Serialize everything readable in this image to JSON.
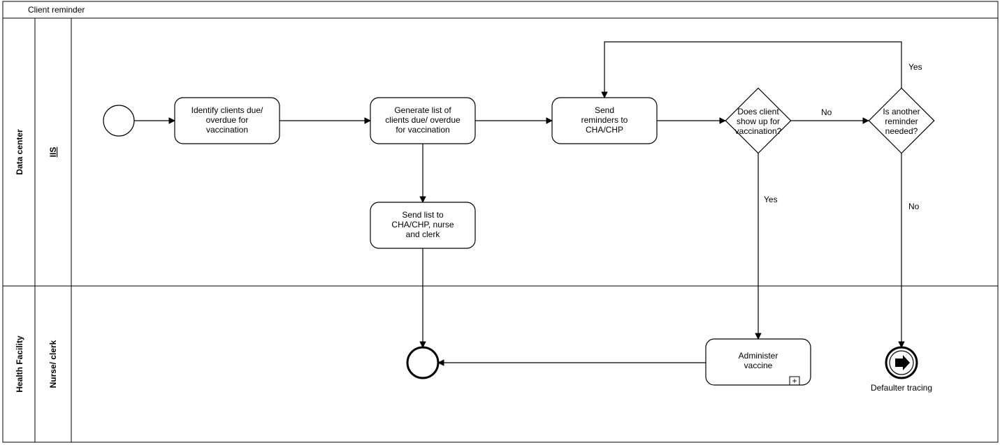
{
  "diagram": {
    "title": "Client reminder",
    "pools": {
      "dataCenter": "Data center",
      "healthFacility": "Health Facility"
    },
    "lanes": {
      "iis": "IIS",
      "nurseClerk": "Nurse/ clerk"
    },
    "tasks": {
      "identify": {
        "l1": "Identify clients due/",
        "l2": "overdue for",
        "l3": "vaccination"
      },
      "generate": {
        "l1": "Generate list of",
        "l2": "clients due/ overdue",
        "l3": "for vaccination"
      },
      "sendReminders": {
        "l1": "Send",
        "l2": "reminders to",
        "l3": "CHA/CHP"
      },
      "sendList": {
        "l1": "Send list to",
        "l2": "CHA/CHP, nurse",
        "l3": "and clerk"
      },
      "administer": {
        "l1": "Administer",
        "l2": "vaccine"
      }
    },
    "gateways": {
      "showUp": {
        "l1": "Does client",
        "l2": "show up for",
        "l3": "vaccination?"
      },
      "anotherReminder": {
        "l1": "Is another",
        "l2": "reminder",
        "l3": "needed?"
      }
    },
    "labels": {
      "yes": "Yes",
      "no": "No"
    },
    "endLink": "Defaulter tracing",
    "subprocessMarker": "+"
  },
  "chart_data": {
    "type": "bpmn-diagram",
    "title": "Client reminder",
    "pools": [
      {
        "name": "Data center",
        "lanes": [
          {
            "name": "IIS",
            "elements": [
              {
                "id": "start",
                "type": "startEvent"
              },
              {
                "id": "identify",
                "type": "task",
                "label": "Identify clients due/ overdue for vaccination"
              },
              {
                "id": "generate",
                "type": "task",
                "label": "Generate list of clients due/ overdue for vaccination"
              },
              {
                "id": "sendReminders",
                "type": "task",
                "label": "Send reminders to CHA/CHP"
              },
              {
                "id": "sendList",
                "type": "task",
                "label": "Send list to CHA/CHP, nurse and clerk"
              },
              {
                "id": "gwShowUp",
                "type": "exclusiveGateway",
                "label": "Does client show up for vaccination?"
              },
              {
                "id": "gwAnother",
                "type": "exclusiveGateway",
                "label": "Is another reminder needed?"
              }
            ]
          }
        ]
      },
      {
        "name": "Health Facility",
        "lanes": [
          {
            "name": "Nurse/ clerk",
            "elements": [
              {
                "id": "intermediate",
                "type": "intermediateEvent"
              },
              {
                "id": "administer",
                "type": "subProcess",
                "label": "Administer vaccine"
              },
              {
                "id": "endLink",
                "type": "linkEndEvent",
                "label": "Defaulter tracing"
              }
            ]
          }
        ]
      }
    ],
    "flows": [
      {
        "from": "start",
        "to": "identify"
      },
      {
        "from": "identify",
        "to": "generate"
      },
      {
        "from": "generate",
        "to": "sendReminders"
      },
      {
        "from": "generate",
        "to": "sendList"
      },
      {
        "from": "sendReminders",
        "to": "gwShowUp"
      },
      {
        "from": "gwShowUp",
        "to": "gwAnother",
        "label": "No"
      },
      {
        "from": "gwShowUp",
        "to": "administer",
        "label": "Yes"
      },
      {
        "from": "gwAnother",
        "to": "sendReminders",
        "label": "Yes"
      },
      {
        "from": "gwAnother",
        "to": "endLink",
        "label": "No"
      },
      {
        "from": "sendList",
        "to": "intermediate"
      },
      {
        "from": "administer",
        "to": "intermediate"
      }
    ]
  }
}
